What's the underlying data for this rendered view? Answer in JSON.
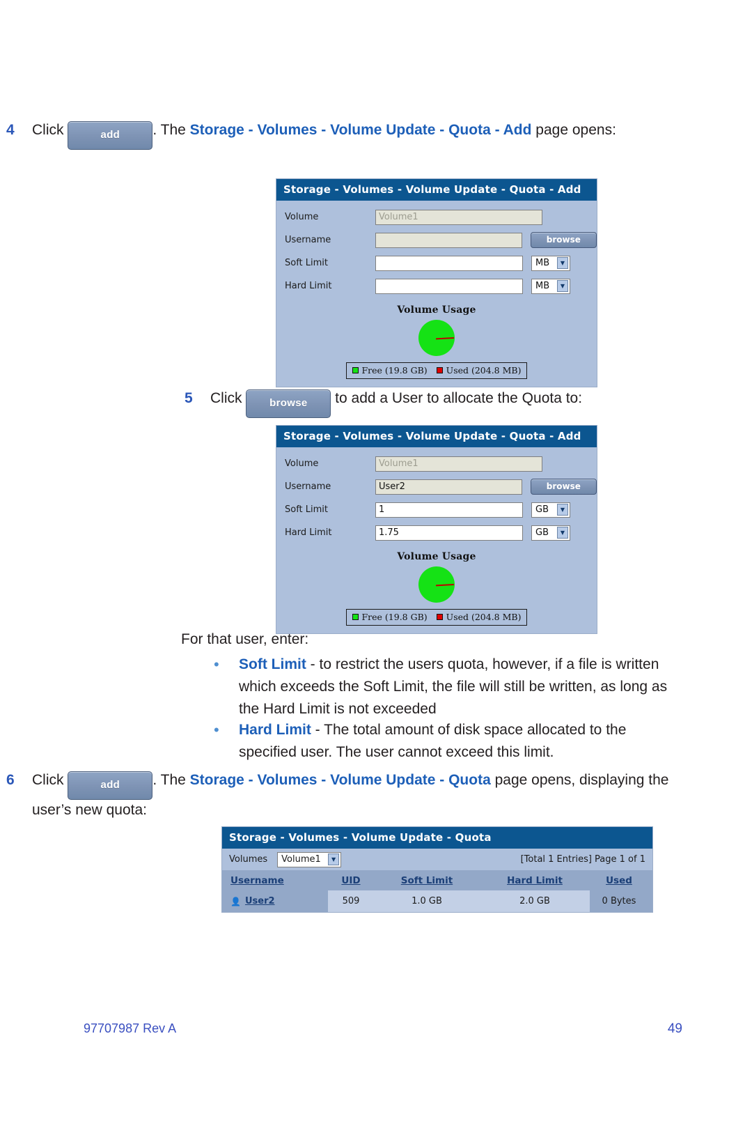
{
  "steps": {
    "step4": {
      "number": "4",
      "click_label": "Click",
      "button_label": "add",
      "text_after_button": ". The ",
      "bold_title": "Storage - Volumes - Volume Update - Quota - Add",
      "tail": " page opens:"
    },
    "step5": {
      "number": "5",
      "click_label": "Click",
      "button_label": "browse",
      "tail": " to add a User to allocate the Quota to:"
    },
    "step6": {
      "number": "6",
      "click_label": "Click",
      "button_label": "add",
      "text_after_button": ". The ",
      "bold_title": "Storage - Volumes - Volume Update - Quota",
      "tail": " page opens, displaying the user’s new quota:"
    }
  },
  "intro_line": "For that user, enter:",
  "bullets": [
    {
      "marker": "•",
      "term": "Soft Limit",
      "description": " - to restrict the users quota, however, if a file is written which exceeds the Soft Limit, the file will still be written, as long as the Hard Limit is not exceeded"
    },
    {
      "marker": "•",
      "term": "Hard Limit",
      "description": " - The total amount of disk space allocated to the specified user. The user cannot exceed this limit."
    }
  ],
  "screenshot_add_empty": {
    "title": "Storage - Volumes - Volume Update - Quota - Add",
    "fields": {
      "volume": {
        "label": "Volume",
        "value": "Volume1",
        "readonly": true
      },
      "username": {
        "label": "Username",
        "value": "",
        "browse_label": "browse"
      },
      "soft_limit": {
        "label": "Soft Limit",
        "value": "",
        "unit": "MB"
      },
      "hard_limit": {
        "label": "Hard Limit",
        "value": "",
        "unit": "MB"
      }
    },
    "usage": {
      "title": "Volume Usage",
      "legend_free": "Free (19.8 GB)",
      "legend_used": "Used (204.8 MB)"
    }
  },
  "screenshot_add_filled": {
    "title": "Storage - Volumes - Volume Update - Quota - Add",
    "fields": {
      "volume": {
        "label": "Volume",
        "value": "Volume1",
        "readonly": true
      },
      "username": {
        "label": "Username",
        "value": "User2",
        "browse_label": "browse"
      },
      "soft_limit": {
        "label": "Soft Limit",
        "value": "1",
        "unit": "GB"
      },
      "hard_limit": {
        "label": "Hard Limit",
        "value": "1.75",
        "unit": "GB"
      }
    },
    "usage": {
      "title": "Volume Usage",
      "legend_free": "Free (19.8 GB)",
      "legend_used": "Used (204.8 MB)"
    }
  },
  "screenshot_quota_table": {
    "title": "Storage - Volumes - Volume Update - Quota",
    "toolbar": {
      "volumes_label": "Volumes",
      "volumes_value": "Volume1",
      "entries_text": "[Total 1 Entries] Page 1 of 1"
    },
    "columns": [
      "Username",
      "UID",
      "Soft Limit",
      "Hard Limit",
      "Used"
    ],
    "rows": [
      {
        "username": "User2",
        "uid": "509",
        "soft_limit": "1.0 GB",
        "hard_limit": "2.0 GB",
        "used": "0 Bytes"
      }
    ]
  },
  "chart_data": {
    "type": "pie",
    "title": "Volume Usage",
    "labels": [
      "Free (19.8 GB)",
      "Used (204.8 MB)"
    ],
    "values": [
      19.8,
      0.2
    ],
    "unit": "GB",
    "colors": [
      "#15e215",
      "#c00000"
    ],
    "legend": "bottom"
  },
  "footer": {
    "doc_id": "97707987 Rev A",
    "page_number": "49"
  },
  "colors": {
    "accent_blue": "#1d5fb8",
    "titlebar": "#0c5690",
    "panel_bg": "#aec0dc",
    "free": "#15e215",
    "used": "#c00000",
    "footer_blue": "#3a4fc0"
  }
}
